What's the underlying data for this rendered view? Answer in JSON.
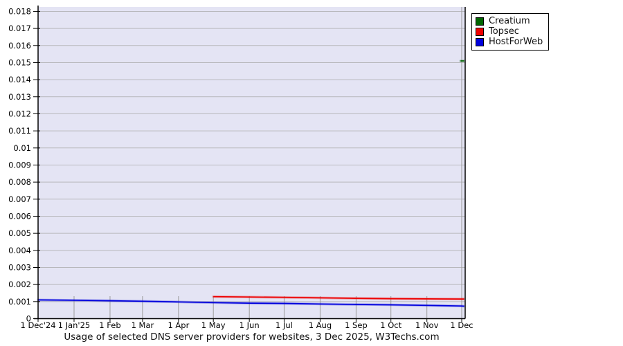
{
  "title": "Usage of selected DNS server providers for websites, 3 Dec 2025, W3Techs.com",
  "legend": {
    "items": [
      {
        "id": "creatium",
        "label": "Creatium",
        "color": "#006400"
      },
      {
        "id": "topsec",
        "label": "Topsec",
        "color": "#ee0000"
      },
      {
        "id": "hostforweb",
        "label": "HostForWeb",
        "color": "#0000dd"
      }
    ]
  },
  "chart_data": {
    "type": "line",
    "title": "Usage of selected DNS server providers for websites, 3 Dec 2025, W3Techs.com",
    "xlabel": "",
    "ylabel": "",
    "ylim": [
      0,
      0.01828
    ],
    "grid": "horizontal",
    "legend_position": "outside-top-right",
    "plot_bg_color": "#e4e4f4",
    "gridline_color": "#b8b8bc",
    "month_tick_color": "#9a9a9a",
    "y_ticks": [
      {
        "value": 0,
        "label": "0"
      },
      {
        "value": 0.001,
        "label": "0.001"
      },
      {
        "value": 0.002,
        "label": "0.002"
      },
      {
        "value": 0.003,
        "label": "0.003"
      },
      {
        "value": 0.004,
        "label": "0.004"
      },
      {
        "value": 0.005,
        "label": "0.005"
      },
      {
        "value": 0.006,
        "label": "0.006"
      },
      {
        "value": 0.007,
        "label": "0.007"
      },
      {
        "value": 0.008,
        "label": "0.008"
      },
      {
        "value": 0.009,
        "label": "0.009"
      },
      {
        "value": 0.01,
        "label": "0.01"
      },
      {
        "value": 0.011,
        "label": "0.011"
      },
      {
        "value": 0.012,
        "label": "0.012"
      },
      {
        "value": 0.013,
        "label": "0.013"
      },
      {
        "value": 0.014,
        "label": "0.014"
      },
      {
        "value": 0.015,
        "label": "0.015"
      },
      {
        "value": 0.016,
        "label": "0.016"
      },
      {
        "value": 0.017,
        "label": "0.017"
      },
      {
        "value": 0.018,
        "label": "0.018"
      }
    ],
    "x_ticks": [
      {
        "day": 0,
        "label": "1 Dec'24"
      },
      {
        "day": 31,
        "label": "1 Jan'25"
      },
      {
        "day": 62,
        "label": "1 Feb"
      },
      {
        "day": 90,
        "label": "1 Mar"
      },
      {
        "day": 121,
        "label": "1 Apr"
      },
      {
        "day": 151,
        "label": "1 May"
      },
      {
        "day": 182,
        "label": "1 Jun"
      },
      {
        "day": 212,
        "label": "1 Jul"
      },
      {
        "day": 243,
        "label": "1 Aug"
      },
      {
        "day": 274,
        "label": "1 Sep"
      },
      {
        "day": 304,
        "label": "1 Oct"
      },
      {
        "day": 335,
        "label": "1 Nov"
      },
      {
        "day": 365,
        "label": "1 Dec"
      }
    ],
    "x_total_days": 367,
    "series": [
      {
        "name": "Creatium",
        "color": "#006400",
        "points": [
          [
            364,
            0.0151
          ],
          [
            367,
            0.0151
          ]
        ]
      },
      {
        "name": "Topsec",
        "color": "#ee0000",
        "points": [
          [
            151,
            0.00129
          ],
          [
            182,
            0.00127
          ],
          [
            212,
            0.00125
          ],
          [
            243,
            0.00122
          ],
          [
            274,
            0.00119
          ],
          [
            304,
            0.00117
          ],
          [
            335,
            0.00116
          ],
          [
            365,
            0.00115
          ],
          [
            367,
            0.00115
          ]
        ]
      },
      {
        "name": "HostForWeb",
        "color": "#0000dd",
        "points": [
          [
            0,
            0.0011
          ],
          [
            31,
            0.00108
          ],
          [
            62,
            0.00105
          ],
          [
            90,
            0.00102
          ],
          [
            121,
            0.00098
          ],
          [
            151,
            0.00094
          ],
          [
            182,
            0.00091
          ],
          [
            212,
            0.00089
          ],
          [
            243,
            0.00086
          ],
          [
            274,
            0.00083
          ],
          [
            304,
            0.00081
          ],
          [
            335,
            0.00078
          ],
          [
            365,
            0.00074
          ],
          [
            367,
            0.00073
          ]
        ]
      }
    ]
  }
}
